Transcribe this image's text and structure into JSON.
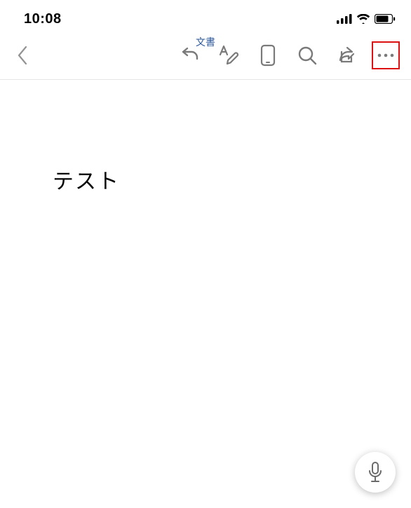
{
  "status": {
    "time": "10:08"
  },
  "toolbar": {
    "doc_label": "文書"
  },
  "document": {
    "body_text": "テスト"
  }
}
